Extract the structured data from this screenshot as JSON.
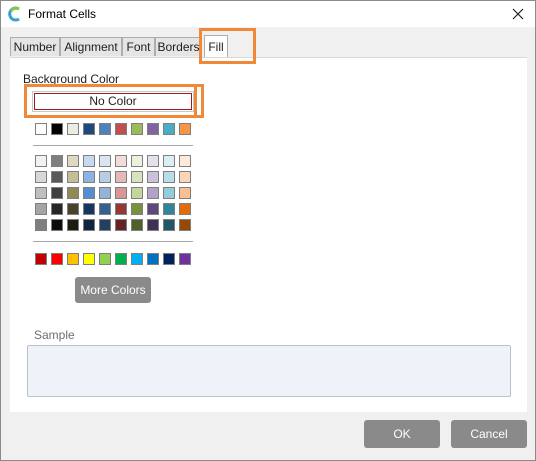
{
  "window": {
    "title": "Format Cells"
  },
  "tabs": [
    "Number",
    "Alignment",
    "Font",
    "Borders",
    "Fill"
  ],
  "active_tab": "Fill",
  "fill": {
    "background_label": "Background Color",
    "no_color_label": "No Color",
    "more_colors_label": "More Colors",
    "sample_label": "Sample",
    "theme_row": [
      "#ffffff",
      "#000000",
      "#eeece1",
      "#1f497d",
      "#4f81bd",
      "#c0504d",
      "#9bbb59",
      "#8064a2",
      "#4bacc6",
      "#f79646"
    ],
    "tint_rows": [
      [
        "#f2f2f2",
        "#7f7f7f",
        "#ddd9c3",
        "#c6d9f0",
        "#dbe5f1",
        "#f2dcdb",
        "#ebf1dd",
        "#e5e0ec",
        "#dbeef3",
        "#fdeada"
      ],
      [
        "#d8d8d8",
        "#595959",
        "#c4bd97",
        "#8db3e2",
        "#b8cce4",
        "#e5b9b7",
        "#d7e3bc",
        "#ccc1d9",
        "#b7dde8",
        "#fbd5b5"
      ],
      [
        "#bfbfbf",
        "#3f3f3f",
        "#938953",
        "#548dd4",
        "#95b3d7",
        "#d99694",
        "#c3d69b",
        "#b2a2c7",
        "#92cddc",
        "#fac08f"
      ],
      [
        "#a5a5a5",
        "#262626",
        "#494429",
        "#17365d",
        "#366092",
        "#953734",
        "#76923c",
        "#5f497a",
        "#31859b",
        "#e36c09"
      ],
      [
        "#7f7f7f",
        "#0c0c0c",
        "#1d1b10",
        "#0f243e",
        "#244061",
        "#632423",
        "#4f6128",
        "#3f3151",
        "#205867",
        "#974806"
      ]
    ],
    "standard_row": [
      "#c00000",
      "#ff0000",
      "#ffc000",
      "#ffff00",
      "#92d050",
      "#00b050",
      "#00b0f0",
      "#0070c0",
      "#002060",
      "#7030a0"
    ]
  },
  "buttons": {
    "ok": "OK",
    "cancel": "Cancel"
  },
  "colors": {
    "highlight": "#f0883a",
    "button_gray": "#8a8a8a",
    "no_color_border": "#9b1c1c"
  }
}
